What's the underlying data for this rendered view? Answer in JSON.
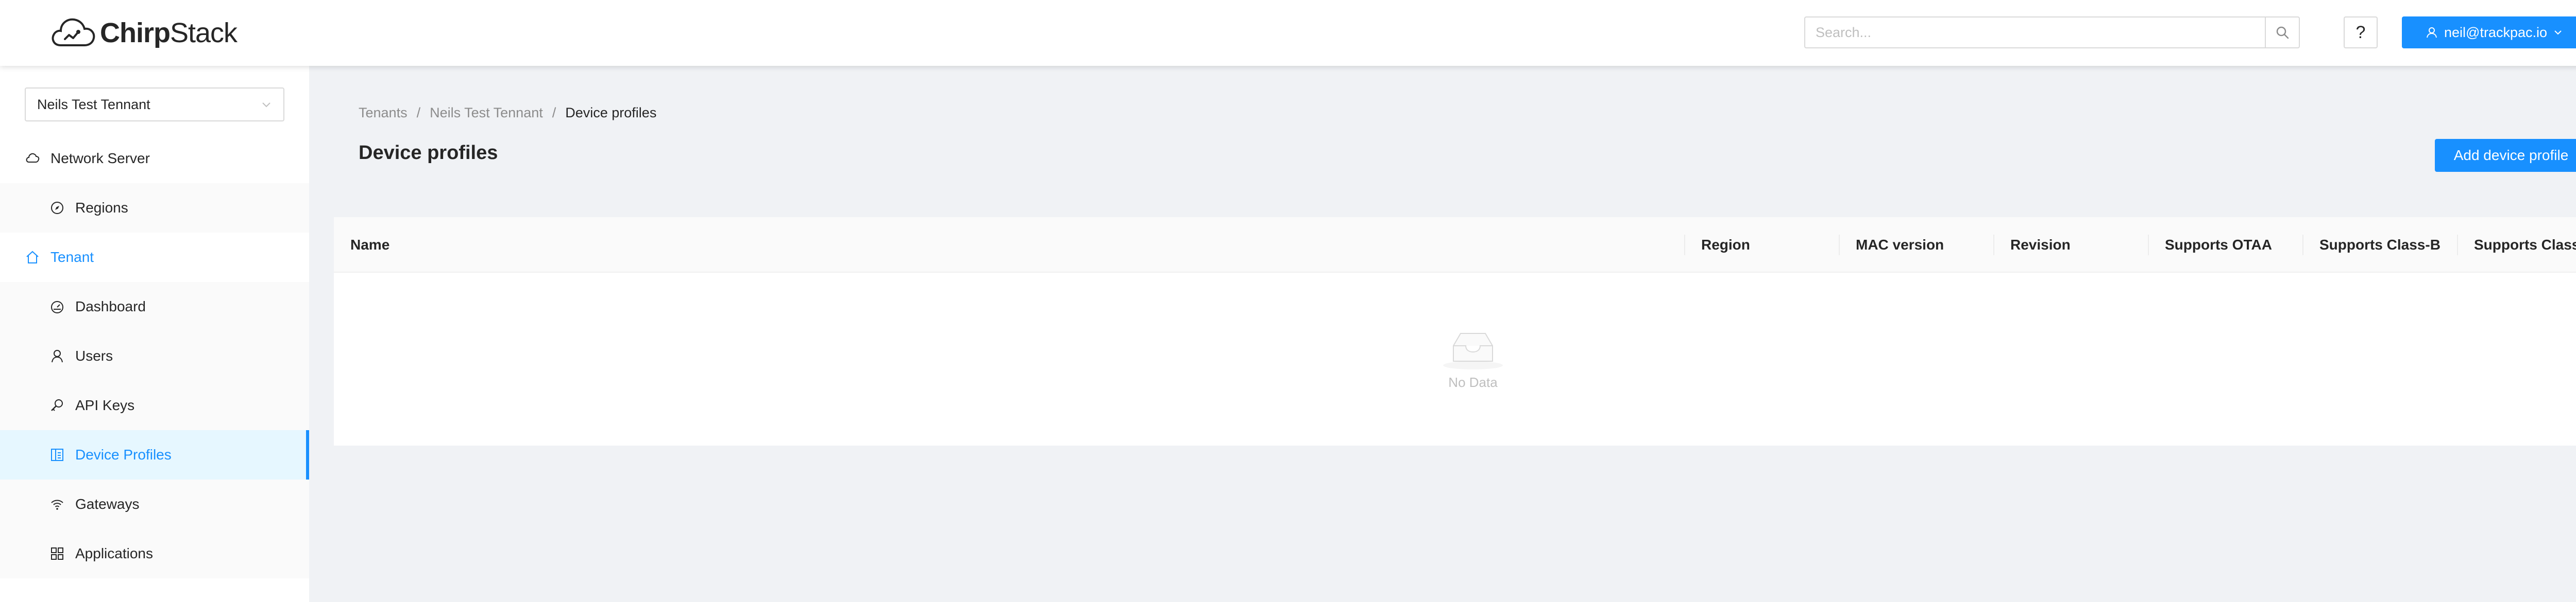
{
  "header": {
    "logo_bold": "Chirp",
    "logo_regular": "Stack",
    "search_placeholder": "Search...",
    "help_label": "?",
    "user_label": "neil@trackpac.io"
  },
  "sidebar": {
    "tenant_selected": "Neils Test Tennant",
    "items": [
      {
        "label": "Network Server"
      },
      {
        "label": "Regions"
      },
      {
        "label": "Tenant"
      },
      {
        "label": "Dashboard"
      },
      {
        "label": "Users"
      },
      {
        "label": "API Keys"
      },
      {
        "label": "Device Profiles"
      },
      {
        "label": "Gateways"
      },
      {
        "label": "Applications"
      }
    ]
  },
  "breadcrumb": [
    "Tenants",
    "/",
    "Neils Test Tennant",
    "/",
    "Device profiles"
  ],
  "page": {
    "title": "Device profiles",
    "add_button": "Add device profile"
  },
  "table": {
    "columns": [
      "Name",
      "Region",
      "MAC version",
      "Revision",
      "Supports OTAA",
      "Supports Class-B",
      "Supports Class-C"
    ],
    "rows": [],
    "empty_text": "No Data"
  },
  "colors": {
    "accent": "#1890ff",
    "active_bg": "#e6f7ff",
    "page_bg": "#f0f2f5"
  }
}
